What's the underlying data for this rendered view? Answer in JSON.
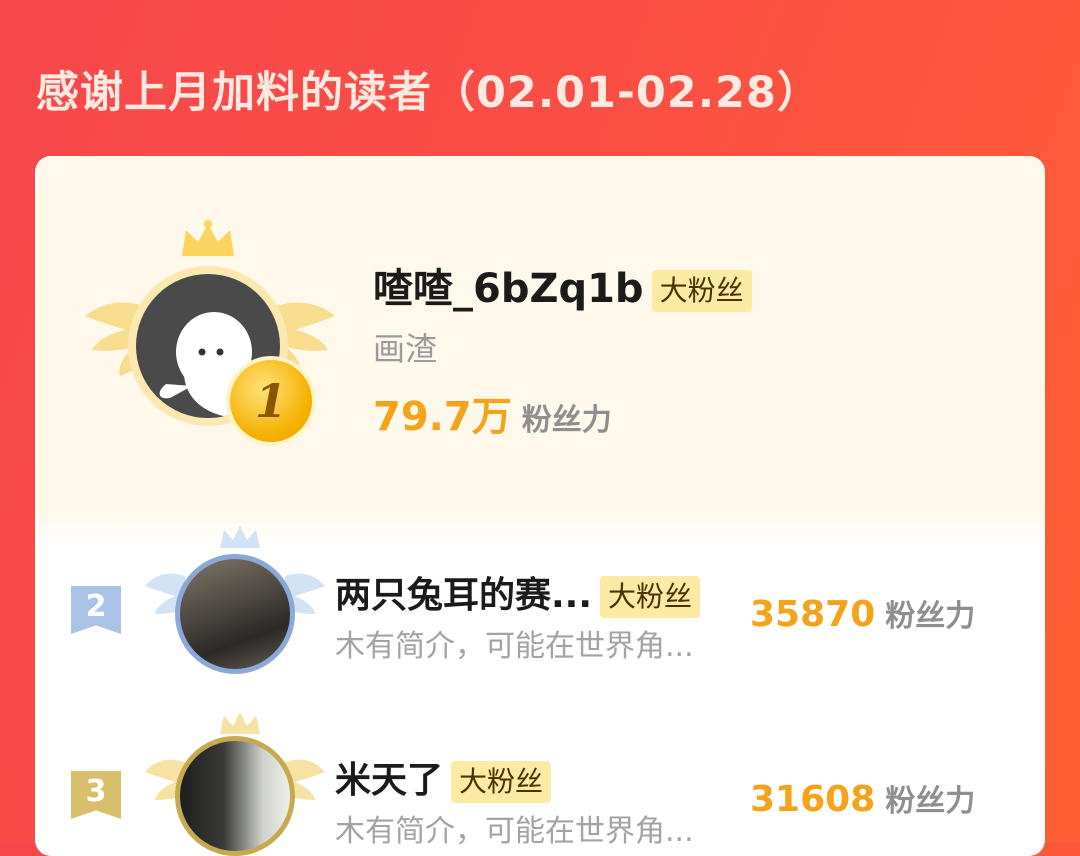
{
  "header": {
    "title": "感谢上月加料的读者（02.01-02.28）"
  },
  "top_fan": {
    "rank": "1",
    "name": "喳喳_6bZq1b",
    "tag": "大粉丝",
    "bio": "画渣",
    "power_value": "79.7万",
    "power_label": "粉丝力"
  },
  "rows": [
    {
      "rank": "2",
      "name": "两只兔耳的赛...",
      "tag": "大粉丝",
      "bio": "木有简介，可能在世界角...",
      "power_value": "35870",
      "power_label": "粉丝力"
    },
    {
      "rank": "3",
      "name": "米天了",
      "tag": "大粉丝",
      "bio": "木有简介，可能在世界角...",
      "power_value": "31608",
      "power_label": "粉丝力"
    }
  ],
  "colors": {
    "background": "#f6484c",
    "accent_power": "#f4a31b",
    "tag_bg": "#fdeba4",
    "rank2": "#a9c3e6",
    "rank3": "#d9bf6a"
  },
  "icons": [
    "crown-icon",
    "wings-icon",
    "default-avatar-icon",
    "rank-medal-icon",
    "rank-ribbon-icon"
  ]
}
